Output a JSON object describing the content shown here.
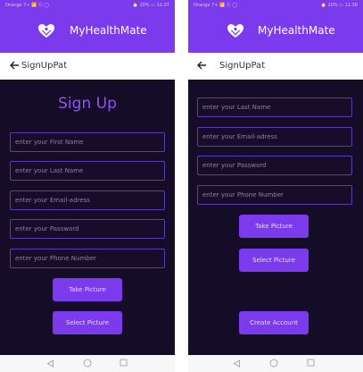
{
  "status_bar": {
    "left": "Orange 7+ 📶 ⓗ ◯",
    "right": "⏰ 20% ▭ 11:37",
    "right_alt": "⏰ 20% ▭ 11:36"
  },
  "header": {
    "app_name": "MyHealthMate",
    "logo_icon": "heart-hands-icon"
  },
  "toolbar": {
    "title": "SignUpPat",
    "back_icon": "arrow-left-icon"
  },
  "form": {
    "title": "Sign Up",
    "first_name_placeholder": "enter your First Name",
    "last_name_placeholder": "enter your Last Name",
    "email_placeholder": "enter your Email-adress",
    "password_placeholder": "enter your Password",
    "phone_placeholder": "enter your Phone Number",
    "take_picture_label": "Take Picture",
    "select_picture_label": "Select Picture",
    "create_account_label": "Create Account"
  },
  "nav": {
    "back_icon": "triangle-back-icon",
    "home_icon": "circle-home-icon",
    "recent_icon": "square-recent-icon"
  },
  "colors": {
    "primary": "#7c3aed",
    "background": "#150c27",
    "field_border": "#5b3cb0",
    "title_accent": "#8f55f0"
  }
}
